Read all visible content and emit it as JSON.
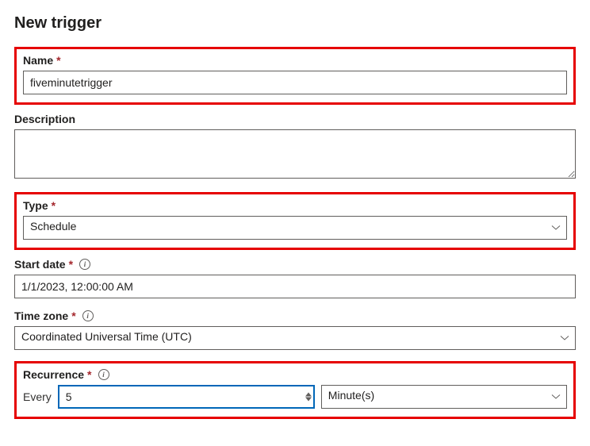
{
  "title": "New trigger",
  "name": {
    "label": "Name",
    "value": "fiveminutetrigger"
  },
  "description": {
    "label": "Description",
    "value": ""
  },
  "type": {
    "label": "Type",
    "value": "Schedule"
  },
  "startDate": {
    "label": "Start date",
    "value": "1/1/2023, 12:00:00 AM"
  },
  "timeZone": {
    "label": "Time zone",
    "value": "Coordinated Universal Time (UTC)"
  },
  "recurrence": {
    "label": "Recurrence",
    "everyLabel": "Every",
    "everyValue": "5",
    "unitValue": "Minute(s)"
  },
  "requiredMark": "*"
}
